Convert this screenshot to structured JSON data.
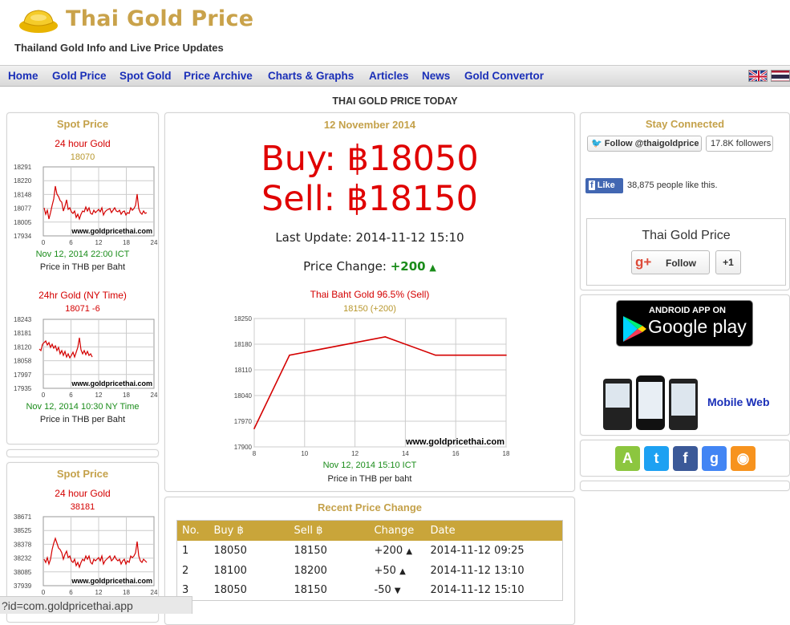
{
  "site": {
    "title": "Thai Gold Price",
    "tagline": "Thailand Gold Info and Live Price Updates"
  },
  "nav": {
    "items": [
      "Home",
      "Gold Price",
      "Spot Gold",
      "Price Archive",
      "Charts & Graphs",
      "Articles",
      "News",
      "Gold Convertor"
    ],
    "flags": [
      "uk-flag",
      "thailand-flag"
    ]
  },
  "heading": "THAI GOLD PRICE TODAY",
  "left": {
    "panel1": {
      "title": "Spot Price",
      "chart1": {
        "title": "24 hour Gold",
        "value": "18070",
        "yticks": [
          "18291",
          "18220",
          "18148",
          "18077",
          "18005",
          "17934"
        ],
        "xticks": [
          "0",
          "6",
          "12",
          "18",
          "24"
        ],
        "watermark": "www.goldpricethai.com",
        "timestamp": "Nov 12, 2014 22:00 ICT",
        "unit": "Price in THB per Baht"
      },
      "chart2": {
        "title": "24hr Gold (NY Time)",
        "value": "18071 -6",
        "yticks": [
          "18243",
          "18181",
          "18120",
          "18058",
          "17997",
          "17935"
        ],
        "xticks": [
          "0",
          "6",
          "12",
          "18",
          "24"
        ],
        "watermark": "www.goldpricethai.com",
        "timestamp": "Nov 12, 2014 10:30 NY Time",
        "unit": "Price in THB per Baht"
      }
    },
    "panel2": {
      "title": "Spot Price",
      "chart1": {
        "title": "24 hour Gold",
        "value": "38181",
        "yticks": [
          "38671",
          "38525",
          "38378",
          "38232",
          "38085",
          "37939"
        ],
        "xticks": [
          "0",
          "6",
          "12",
          "18",
          "24"
        ],
        "watermark": "www.goldpricethai.com"
      }
    }
  },
  "main": {
    "date": "12 November 2014",
    "buy": "Buy: ฿18050",
    "sell": "Sell: ฿18150",
    "last_update": "Last Update: 2014-11-12 15:10",
    "price_change_label": "Price Change:",
    "price_change_value": "+200",
    "chart_title": "Thai Baht Gold 96.5% (Sell)",
    "chart_subtitle": "18150 (+200)",
    "chart_watermark": "www.goldpricethai.com",
    "chart_timestamp": "Nov 12, 2014 15:10 ICT",
    "chart_unit": "Price in THB per baht"
  },
  "chart_data": {
    "type": "line",
    "title": "Thai Baht Gold 96.5% (Sell)",
    "subtitle": "18150 (+200)",
    "x": [
      8,
      9.4,
      13.2,
      15.2,
      18
    ],
    "series": [
      {
        "values": [
          17950,
          18150,
          18200,
          18150,
          18150
        ]
      }
    ],
    "xlim": [
      8,
      18
    ],
    "ylim": [
      17900,
      18250
    ],
    "xticks": [
      8,
      10,
      12,
      14,
      16,
      18
    ],
    "yticks": [
      17900,
      17970,
      18040,
      18110,
      18180,
      18250
    ],
    "grid": true,
    "color": "#d40000"
  },
  "recent": {
    "title": "Recent Price Change",
    "columns": [
      "No.",
      "Buy ฿",
      "Sell ฿",
      "Change",
      "Date"
    ],
    "rows": [
      {
        "no": "1",
        "buy": "18050",
        "sell": "18150",
        "change": "+200",
        "dir": "up",
        "date": "2014-11-12 09:25"
      },
      {
        "no": "2",
        "buy": "18100",
        "sell": "18200",
        "change": "+50",
        "dir": "up",
        "date": "2014-11-12 13:10"
      },
      {
        "no": "3",
        "buy": "18050",
        "sell": "18150",
        "change": "-50",
        "dir": "down",
        "date": "2014-11-12 15:10"
      }
    ]
  },
  "right": {
    "stay_connected": "Stay Connected",
    "twitter_button": "Follow @thaigoldprice",
    "followers": "17.8K followers",
    "fb_like": "Like",
    "fb_count": "38,875 people like this.",
    "gplus_name": "Thai Gold Price",
    "gplus_follow": "Follow",
    "gplus_plus": "+1",
    "android_line1": "ANDROID APP ON",
    "android_line2": "Google play",
    "mobile_web": "Mobile Web",
    "social_icons": [
      "android-icon",
      "twitter-icon",
      "facebook-icon",
      "google-plus-icon",
      "rss-icon"
    ]
  },
  "status_bar": "?id=com.goldpricethai.app",
  "colors": {
    "accent_gold": "#c9a24a",
    "nav_link": "#1a2fb8",
    "price_red": "#e00000",
    "up_green": "#1a8c1a"
  }
}
